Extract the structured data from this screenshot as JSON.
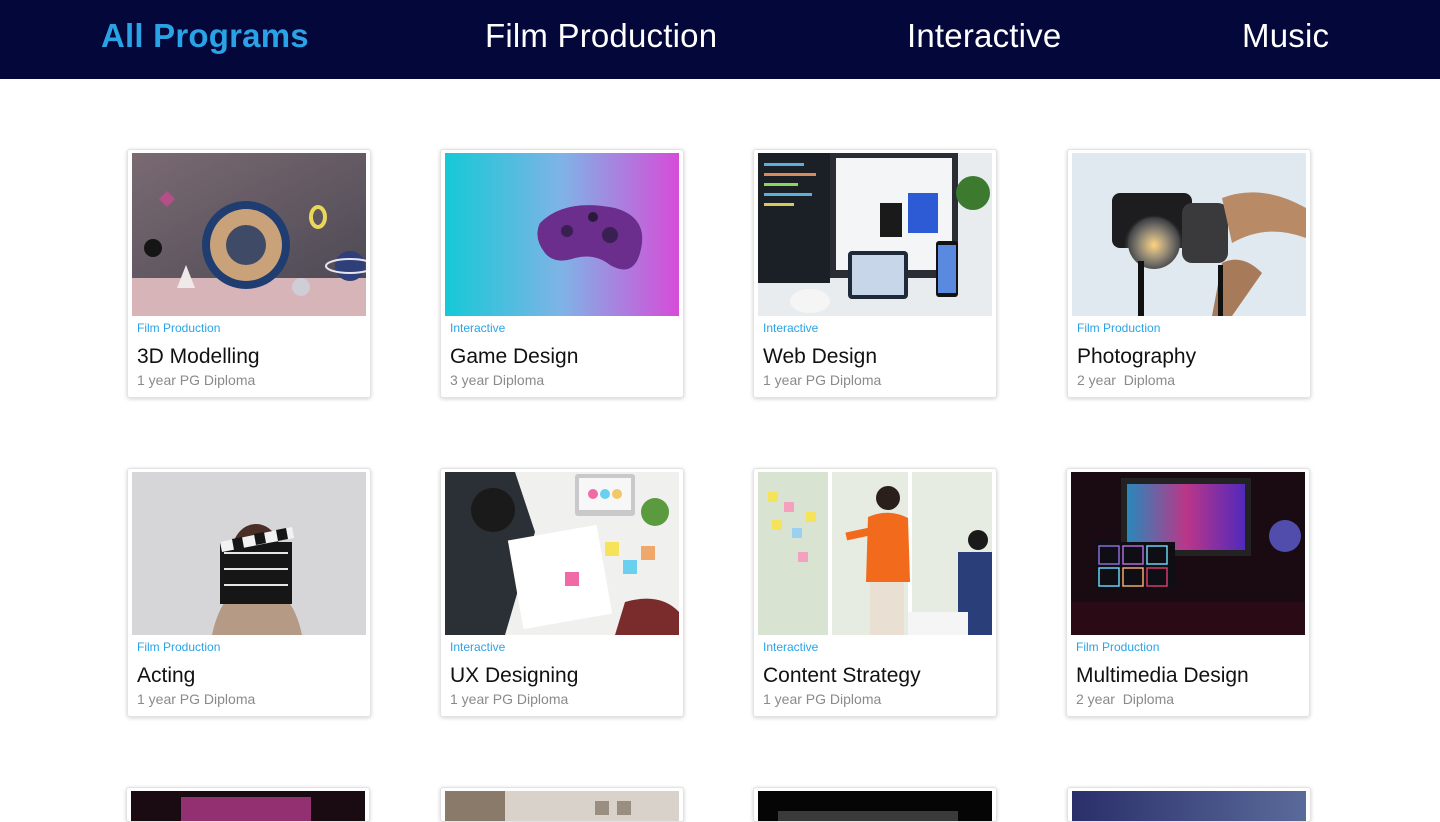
{
  "nav": {
    "tabs": [
      {
        "label": "All Programs",
        "active": true
      },
      {
        "label": "Film Production",
        "active": false
      },
      {
        "label": "Interactive",
        "active": false
      },
      {
        "label": "Music",
        "active": false
      }
    ]
  },
  "colors": {
    "nav_bg": "#03073a",
    "accent": "#2aa3e6",
    "title_text": "#111111",
    "meta_text": "#8a8a8a"
  },
  "programs": [
    {
      "category": "Film Production",
      "title": "3D Modelling",
      "duration": "1 year PG Diploma",
      "image": "3d-sculpture-image"
    },
    {
      "category": "Interactive",
      "title": "Game Design",
      "duration": "3 year Diploma",
      "image": "game-controller-image"
    },
    {
      "category": "Interactive",
      "title": "Web Design",
      "duration": "1 year PG Diploma",
      "image": "web-design-desk-image"
    },
    {
      "category": "Film Production",
      "title": "Photography",
      "duration": "2 year  Diploma",
      "image": "camera-in-hands-image"
    },
    {
      "category": "Film Production",
      "title": "Acting",
      "duration": "1 year PG Diploma",
      "image": "clapperboard-image"
    },
    {
      "category": "Interactive",
      "title": "UX Designing",
      "duration": "1 year PG Diploma",
      "image": "ux-sketching-image"
    },
    {
      "category": "Interactive",
      "title": "Content Strategy",
      "duration": "1 year PG Diploma",
      "image": "sticky-notes-presentation-image"
    },
    {
      "category": "Film Production",
      "title": "Multimedia Design",
      "duration": "2 year  Diploma",
      "image": "multimedia-workstation-image"
    }
  ]
}
